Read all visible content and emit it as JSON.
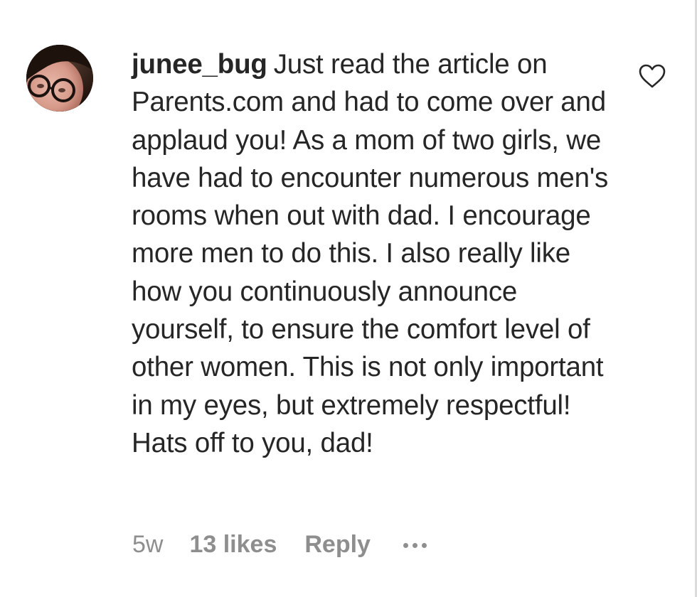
{
  "comment": {
    "username": "junee_bug",
    "text": "Just read the article on Parents.com and had to come over and applaud you! As a mom of two girls, we have had to encounter numerous men's rooms when out with dad. I encourage more men to do this. I also really like how you continuously announce yourself, to ensure the comfort level of other women. This is not only important in my eyes, but extremely respectful! Hats off to you, dad!",
    "time": "5w",
    "likes": "13 likes",
    "reply_label": "Reply",
    "like_icon": "heart-outline-icon",
    "more_icon": "more-horizontal-icon"
  },
  "colors": {
    "text": "#262626",
    "meta": "#8e8e8e",
    "border": "#dbdbdb"
  }
}
